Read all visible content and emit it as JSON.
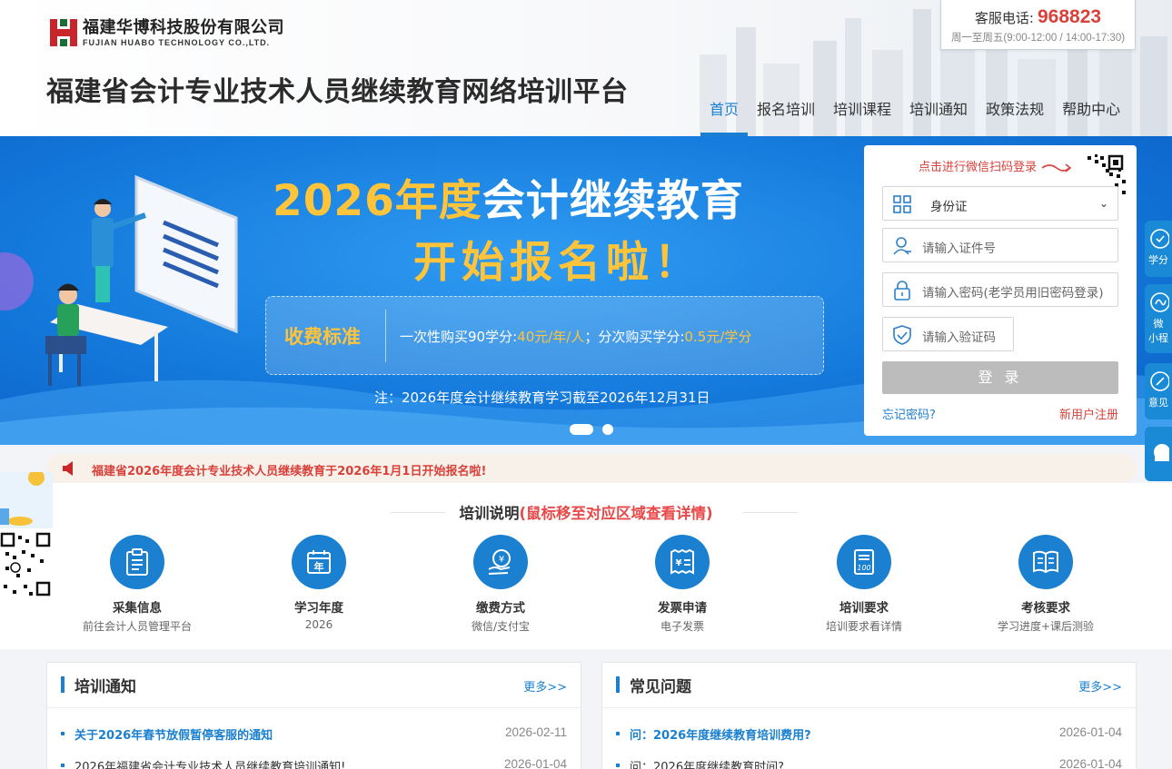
{
  "header": {
    "logo_cn": "福建华博科技股份有限公司",
    "logo_en": "FUJIAN HUABO TECHNOLOGY CO.,LTD.",
    "site_title": "福建省会计专业技术人员继续教育网络培训平台",
    "hotline_label": "客服电话:",
    "hotline_number": "968823",
    "hotline_hours": "周一至周五(9:00-12:00 / 14:00-17:30)"
  },
  "nav": {
    "items": [
      "首页",
      "报名培训",
      "培训课程",
      "培训通知",
      "政策法规",
      "帮助中心"
    ],
    "active_color": "#1a7fd0"
  },
  "banner": {
    "title_year": "2026年度",
    "title_rest": "会计继续教育",
    "title_line2": "开始报名啦！",
    "fee_label": "收费标准",
    "fee_part1": "一次性购买90学分:",
    "fee_price1": "40元/年/人",
    "fee_part2": "；分次购买学分:",
    "fee_price2": "0.5元/学分",
    "note": "注：2026年度会计继续教育学习截至2026年12月31日"
  },
  "login": {
    "wechat_tip": "点击进行微信扫码登录",
    "id_type": "身份证",
    "id_placeholder": "请输入证件号",
    "password_placeholder": "请输入密码(老学员用旧密码登录)",
    "captcha_placeholder": "请输入验证码",
    "login_button": "登 录",
    "forgot": "忘记密码?",
    "register": "新用户注册"
  },
  "side_tabs": [
    "学分",
    "微",
    "小程",
    "意见"
  ],
  "notice": {
    "text": "福建省2026年度会计专业技术人员继续教育于2026年1月1日开始报名啦!"
  },
  "training": {
    "title": "培训说明",
    "title_hint": "(鼠标移至对应区域查看详情)",
    "items": [
      {
        "name": "采集信息",
        "sub": "前往会计人员管理平台",
        "icon": "clipboard-icon"
      },
      {
        "name": "学习年度",
        "sub": "2026",
        "icon": "calendar-year-icon"
      },
      {
        "name": "缴费方式",
        "sub": "微信/支付宝",
        "icon": "payment-hand-icon"
      },
      {
        "name": "发票申请",
        "sub": "电子发票",
        "icon": "invoice-icon"
      },
      {
        "name": "培训要求",
        "sub": "培训要求看详情",
        "icon": "exam-paper-icon"
      },
      {
        "name": "考核要求",
        "sub": "学习进度+课后测验",
        "icon": "open-book-icon"
      }
    ]
  },
  "panels": {
    "notices": {
      "title": "培训通知",
      "more": "更多>>",
      "rows": [
        {
          "text": "关于2026年春节放假暂停客服的通知",
          "date": "2026-02-11"
        },
        {
          "text": "2026年福建省会计专业技术人员继续教育培训通知!",
          "date": "2026-01-04"
        }
      ]
    },
    "faq": {
      "title": "常见问题",
      "more": "更多>>",
      "rows": [
        {
          "text": "问：2026年度继续教育培训费用?",
          "date": "2026-01-04"
        },
        {
          "text": "问：2026年度继续教育时间?",
          "date": "2026-01-04"
        }
      ]
    }
  }
}
